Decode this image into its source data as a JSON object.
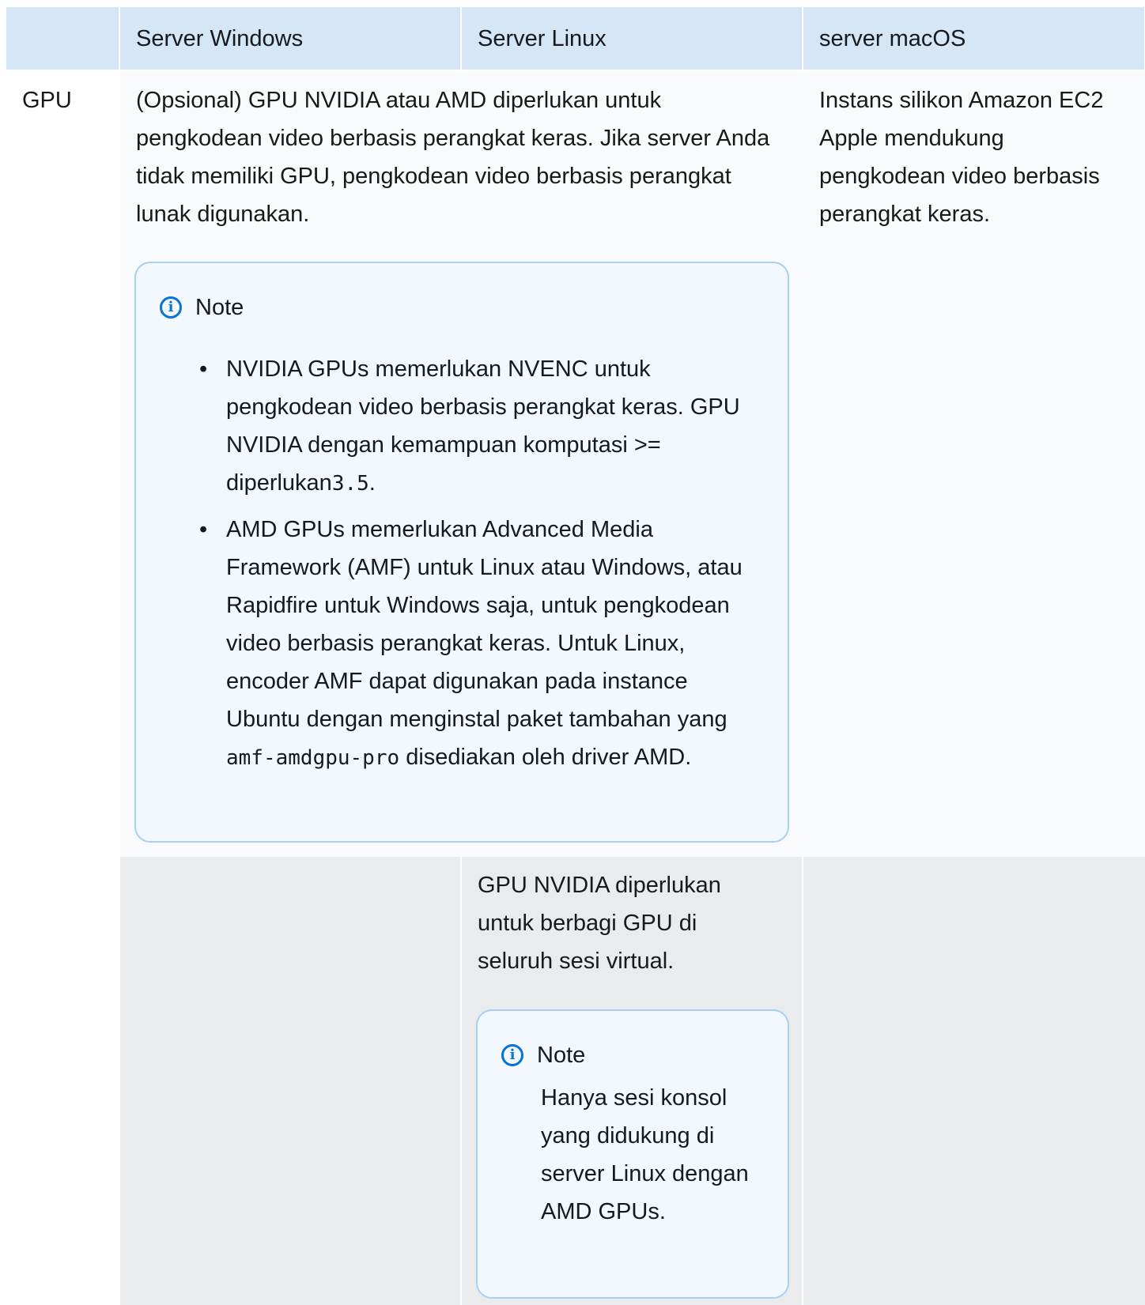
{
  "table": {
    "headers": [
      "",
      "Server Windows",
      "Server Linux",
      "server macOS"
    ],
    "gpu_row": {
      "label": "GPU",
      "windows_linux_text": "(Opsional) GPU NVIDIA atau AMD diperlukan untuk pengkodean video berbasis perangkat keras. Jika server Anda tidak memiliki GPU, pengkodean video berbasis perangkat lunak digunakan.",
      "macos_text": "Instans silikon Amazon EC2 Apple mendukung pengkodean video berbasis perangkat keras.",
      "note": {
        "title": "Note",
        "item1_text": "NVIDIA GPUs memerlukan NVENC untuk pengkodean video berbasis perangkat keras. GPU NVIDIA dengan kemampuan komputasi >= diperlukan",
        "item1_code": "3.5",
        "item1_end": ".",
        "item2_text": "AMD GPUs memerlukan Advanced Media Framework (AMF) untuk Linux atau Windows, atau Rapidfire untuk Windows saja, untuk pengkodean video berbasis perangkat keras. Untuk Linux, encoder AMF dapat digunakan pada instance Ubuntu dengan menginstal paket tambahan yang",
        "item2_code": "amf-amdgpu-pro",
        "item2_end": " disediakan oleh driver AMD."
      }
    },
    "sharing_row": {
      "linux_text": "GPU NVIDIA diperlukan untuk berbagi GPU di seluruh sesi virtual.",
      "note": {
        "title": "Note",
        "body": "Hanya sesi konsol yang didukung di server Linux dengan AMD GPUs."
      }
    }
  }
}
